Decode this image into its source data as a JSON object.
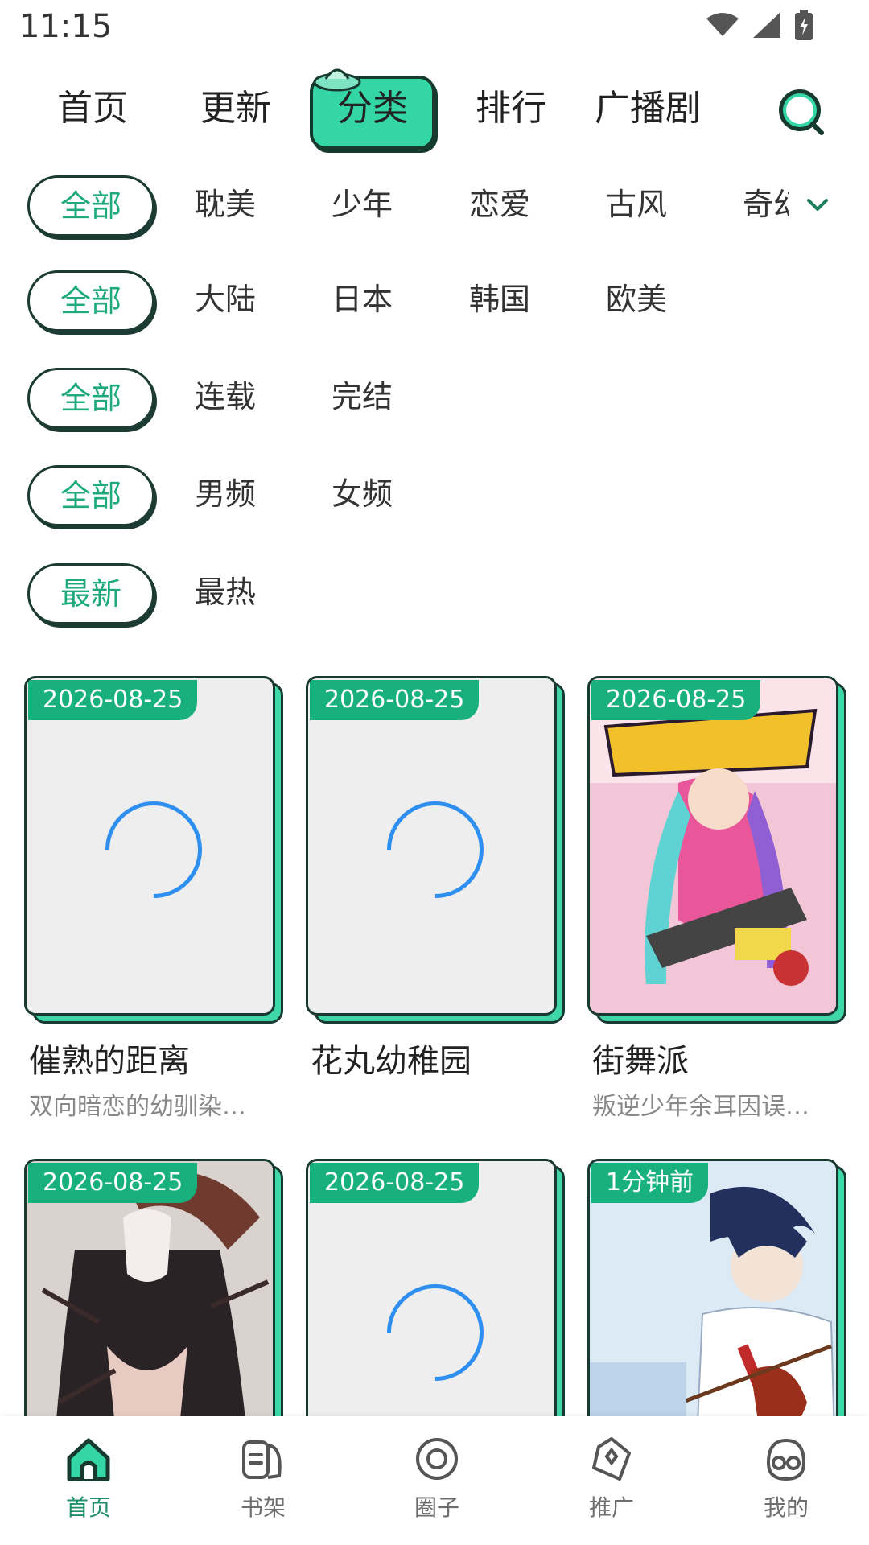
{
  "status_bar": {
    "time": "11:15",
    "icons": [
      "wifi-icon",
      "signal-icon",
      "battery-charging-icon"
    ]
  },
  "top_nav": {
    "tabs": [
      {
        "label": "首页"
      },
      {
        "label": "更新"
      },
      {
        "label": "分类",
        "active": true
      },
      {
        "label": "排行"
      },
      {
        "label": "广播剧"
      }
    ],
    "search_icon": "search-icon"
  },
  "filters": [
    {
      "selected": "全部",
      "options": [
        "耽美",
        "少年",
        "恋爱",
        "古风",
        "奇幻"
      ]
    },
    {
      "selected": "全部",
      "options": [
        "大陆",
        "日本",
        "韩国",
        "欧美"
      ]
    },
    {
      "selected": "全部",
      "options": [
        "连载",
        "完结"
      ]
    },
    {
      "selected": "全部",
      "options": [
        "男频",
        "女频"
      ]
    },
    {
      "selected": "最新",
      "options": [
        "最热"
      ]
    }
  ],
  "comics": [
    {
      "date": "2026-08-25",
      "title": "催熟的距离",
      "desc": "双向暗恋的幼驯染…",
      "cover": "loading"
    },
    {
      "date": "2026-08-25",
      "title": "花丸幼稚园",
      "desc": "",
      "cover": "loading"
    },
    {
      "date": "2026-08-25",
      "title": "街舞派",
      "desc": "叛逆少年余耳因误…",
      "cover": "image"
    },
    {
      "date": "2026-08-25",
      "title": "",
      "desc": "",
      "cover": "image"
    },
    {
      "date": "2026-08-25",
      "title": "",
      "desc": "",
      "cover": "loading"
    },
    {
      "date": "1分钟前",
      "title": "",
      "desc": "",
      "cover": "image"
    }
  ],
  "bottom_nav": [
    {
      "label": "首页",
      "icon": "home-icon",
      "active": true
    },
    {
      "label": "书架",
      "icon": "bookshelf-icon"
    },
    {
      "label": "圈子",
      "icon": "circle-icon"
    },
    {
      "label": "推广",
      "icon": "promote-icon"
    },
    {
      "label": "我的",
      "icon": "profile-icon"
    }
  ],
  "colors": {
    "accent": "#34d6a6",
    "badge": "#18b07c",
    "outline": "#193a31",
    "spinner": "#2f8ff0"
  }
}
